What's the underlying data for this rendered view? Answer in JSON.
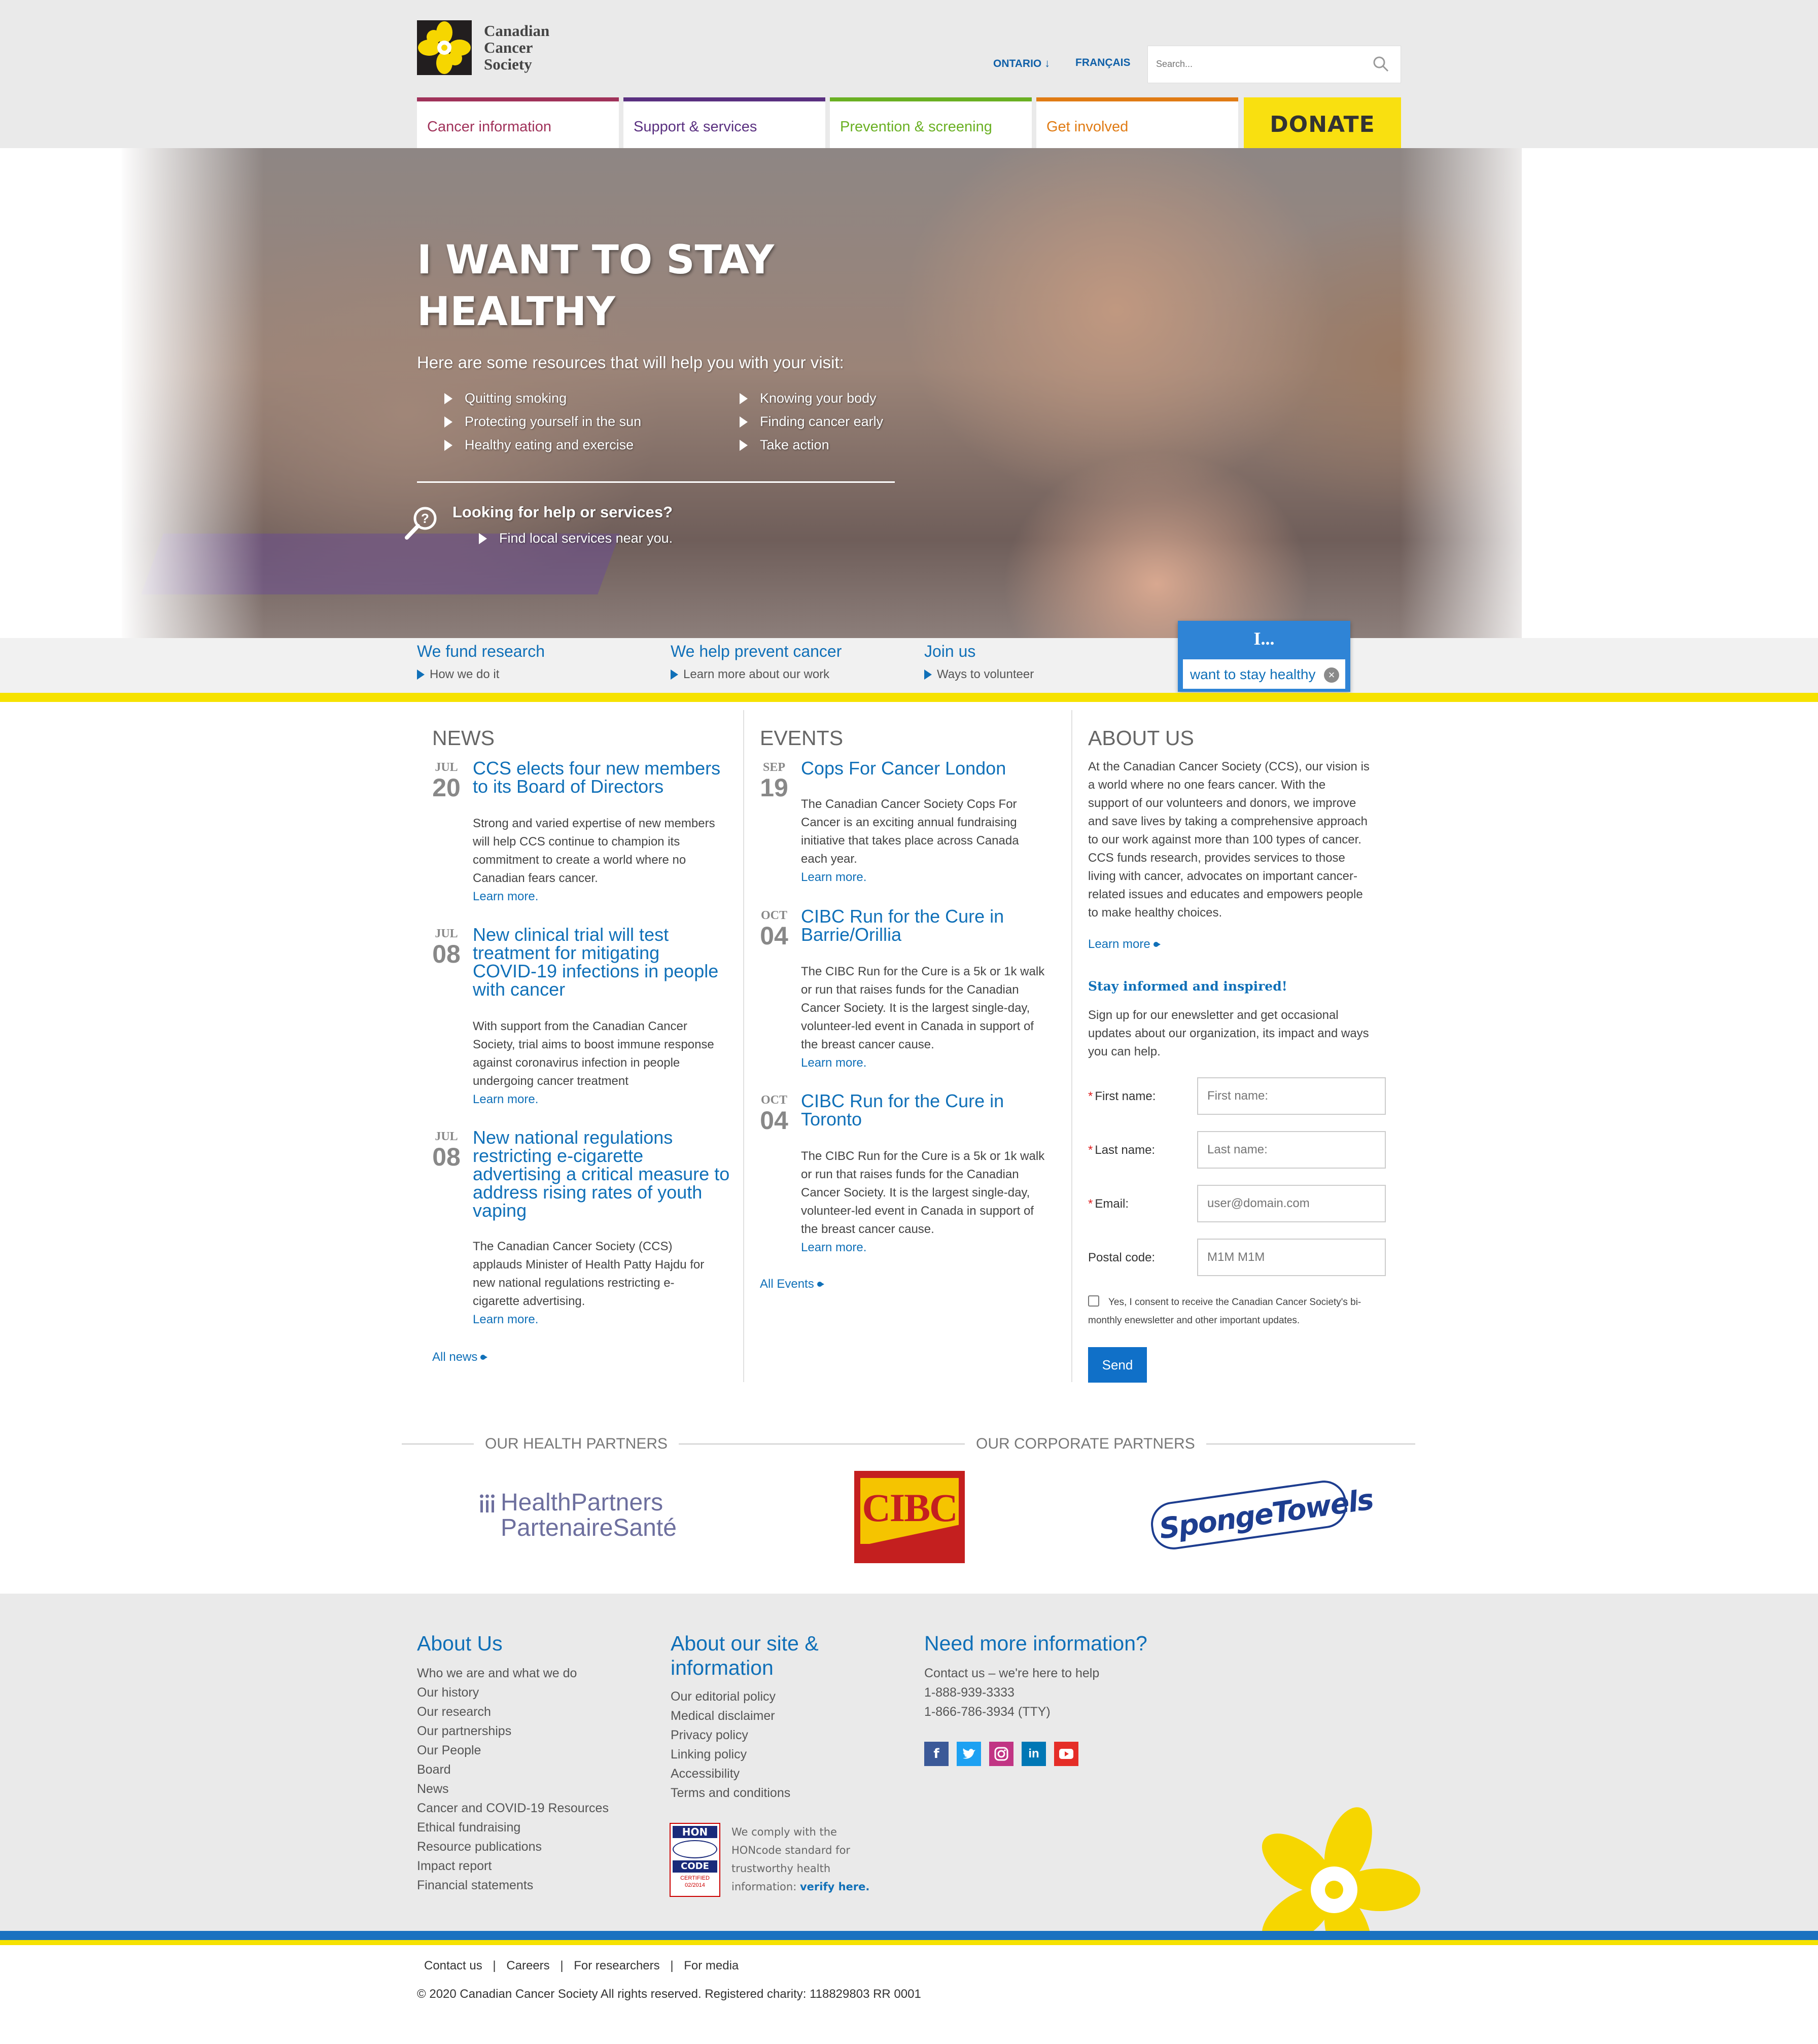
{
  "logo": {
    "line1": "Canadian",
    "line2": "Cancer",
    "line3": "Society"
  },
  "topbar": {
    "region": "ONTARIO",
    "language": "FRANÇAIS",
    "search_placeholder": "Search..."
  },
  "nav": {
    "tabs": [
      {
        "label": "Cancer information",
        "color": "#a0325a"
      },
      {
        "label": "Support & services",
        "color": "#5a3080"
      },
      {
        "label": "Prevention & screening",
        "color": "#6ab023"
      },
      {
        "label": "Get involved",
        "color": "#e07b14"
      }
    ],
    "donate": "DONATE"
  },
  "hero": {
    "title": "I WANT TO STAY HEALTHY",
    "intro": "Here are some resources that will help you with your visit:",
    "links_left": [
      "Quitting smoking",
      "Protecting yourself in the sun",
      "Healthy eating and exercise"
    ],
    "links_right": [
      "Knowing your body",
      "Finding cancer early",
      "Take action"
    ],
    "help_title": "Looking for help or services?",
    "help_link": "Find local services near you."
  },
  "strip": {
    "items": [
      {
        "title": "We fund research",
        "link": "How we do it"
      },
      {
        "title": "We help prevent cancer",
        "link": "Learn more about our work"
      },
      {
        "title": "Join us",
        "link": "Ways to volunteer"
      }
    ],
    "i_label": "I...",
    "i_selected": "want to stay healthy"
  },
  "news": {
    "heading": "NEWS",
    "items": [
      {
        "month": "JUL",
        "day": "20",
        "title_lines": [
          "CCS elects four new members",
          "to its Board of Directors"
        ],
        "body_lines": [
          "Strong and varied expertise of new members",
          "will help CCS continue to champion its",
          "commitment to create a world where no",
          "Canadian fears cancer."
        ],
        "more": "Learn more."
      },
      {
        "month": "JUL",
        "day": "08",
        "title_lines": [
          "New clinical trial will test",
          "treatment for mitigating",
          "COVID-19 infections in people",
          "with cancer"
        ],
        "body_lines": [
          "With support from the Canadian Cancer",
          "Society, trial aims to boost immune response",
          "against coronavirus infection in people",
          "undergoing cancer treatment"
        ],
        "more": "Learn more."
      },
      {
        "month": "JUL",
        "day": "08",
        "title_lines": [
          "New national regulations",
          "restricting e-cigarette",
          "advertising a critical measure to",
          "address rising rates of youth",
          "vaping"
        ],
        "body_lines": [
          "The Canadian Cancer Society (CCS)",
          "applauds Minister of Health Patty Hajdu for",
          "new national regulations restricting e-",
          "cigarette advertising."
        ],
        "more": "Learn more."
      }
    ],
    "all": "All news"
  },
  "events": {
    "heading": "EVENTS",
    "items": [
      {
        "month": "SEP",
        "day": "19",
        "title_lines": [
          "Cops For Cancer London"
        ],
        "body_lines": [
          "The Canadian Cancer Society Cops For",
          "Cancer is an exciting annual fundraising",
          "initiative that takes place across Canada",
          "each year."
        ],
        "more": "Learn more."
      },
      {
        "month": "OCT",
        "day": "04",
        "title_lines": [
          "CIBC Run for the Cure in",
          "Barrie/Orillia"
        ],
        "body_lines": [
          "The CIBC Run for the Cure is a 5k or 1k walk",
          "or run that raises funds for the Canadian",
          "Cancer Society. It is the largest single-day,",
          "volunteer-led event in Canada in support of",
          "the breast cancer cause."
        ],
        "more": "Learn more."
      },
      {
        "month": "OCT",
        "day": "04",
        "title_lines": [
          "CIBC Run for the Cure in",
          "Toronto"
        ],
        "body_lines": [
          "The CIBC Run for the Cure is a 5k or 1k walk",
          "or run that raises funds for the Canadian",
          "Cancer Society. It is the largest single-day,",
          "volunteer-led event in Canada in support of",
          "the breast cancer cause."
        ],
        "more": "Learn more."
      }
    ],
    "all": "All Events"
  },
  "about": {
    "heading": "ABOUT US",
    "body_lines": [
      "At the Canadian Cancer Society (CCS), our vision is",
      "a world where no one fears cancer. With the",
      "support of our volunteers and donors, we improve",
      "and save lives by taking a comprehensive approach",
      "to our work against more than 100 types of cancer.",
      "CCS funds research, provides services to those",
      "living with cancer, advocates on important cancer-",
      "related issues and educates and empowers people",
      "to make healthy choices."
    ],
    "more": "Learn more",
    "stay_title": "Stay informed and inspired!",
    "stay_lines": [
      "Sign up for our enewsletter and get occasional",
      "updates about our organization, its impact and ways",
      "you can help."
    ],
    "form": {
      "first_label": "First name:",
      "first_placeholder": "First name:",
      "last_label": "Last name:",
      "last_placeholder": "Last name:",
      "email_label": "Email:",
      "email_placeholder": "user@domain.com",
      "postal_label": "Postal code:",
      "postal_placeholder": "M1M M1M"
    },
    "consent_lines": [
      "Yes, I consent to receive the Canadian Cancer Society's bi-",
      "monthly enewsletter and other important updates."
    ],
    "send": "Send"
  },
  "partners": {
    "health_title": "OUR HEALTH PARTNERS",
    "corporate_title": "OUR CORPORATE PARTNERS",
    "health_logo_line1": "HealthPartners",
    "health_logo_line2": "PartenaireSanté",
    "cibc": "CIBC",
    "sponge": "SpongeTowels"
  },
  "footer": {
    "col1_title": "About Us",
    "col1_links": [
      "Who we are and what we do",
      "Our history",
      "Our research",
      "Our partnerships",
      "Our People",
      "Board",
      "News",
      "Cancer and COVID-19 Resources",
      "Ethical fundraising",
      "Resource publications",
      "Impact report",
      "Financial statements"
    ],
    "col2_title_lines": [
      "About our site &",
      "information"
    ],
    "col2_links": [
      "Our editorial policy",
      "Medical disclaimer",
      "Privacy policy",
      "Linking policy",
      "Accessibility",
      "Terms and conditions"
    ],
    "col3_title": "Need more information?",
    "col3_lines": [
      "Contact us – we're here to help",
      "1-888-939-3333",
      "1-866-786-3934 (TTY)"
    ],
    "social": [
      "facebook-icon",
      "twitter-icon",
      "instagram-icon",
      "linkedin-icon",
      "youtube-icon"
    ],
    "hon_lines": [
      "HON",
      "CODE",
      "CERTIFIED",
      "02/2014"
    ],
    "hon_text_lines": [
      "We comply with the",
      "HONcode standard for",
      "trustworthy health"
    ],
    "hon_text_last": "information:",
    "hon_verify": "verify here.",
    "bottom_links": [
      "Contact us",
      "Careers",
      "For researchers",
      "For media"
    ],
    "copyright": "© 2020 Canadian Cancer Society All rights reserved. Registered charity: 118829803 RR 0001"
  },
  "colors": {
    "brand_blue": "#1070b8",
    "brand_yellow": "#f6e200"
  }
}
